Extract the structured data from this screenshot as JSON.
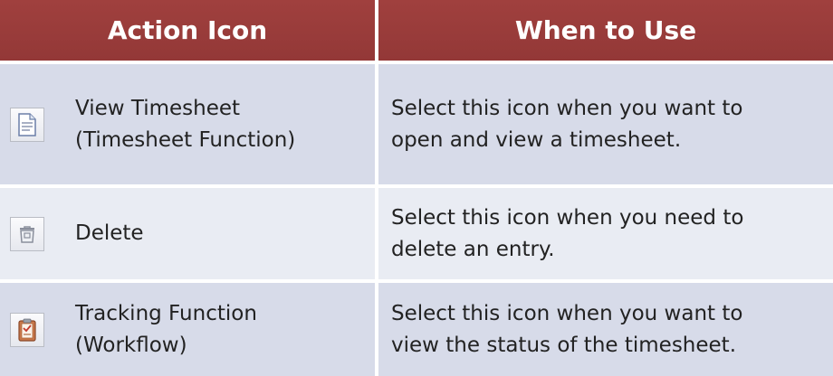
{
  "table": {
    "headers": {
      "action_icon": "Action Icon",
      "when_to_use": "When to Use"
    },
    "rows": [
      {
        "icon": "document-icon",
        "action": "View Timesheet\n(Timesheet Function)",
        "when": "Select this icon when you want to\nopen and view a timesheet."
      },
      {
        "icon": "trash-icon",
        "action": "Delete",
        "when": "Select this icon when you need to\ndelete an entry."
      },
      {
        "icon": "clipboard-icon",
        "action": "Tracking Function\n(Workflow)",
        "when": "Select this icon when you want to\nview the status of the timesheet."
      }
    ]
  },
  "colors": {
    "header_bg": "#9b3c3b",
    "row_bg": "#d7dbe9",
    "row_alt_bg": "#e9ecf3",
    "text": "#222222"
  }
}
